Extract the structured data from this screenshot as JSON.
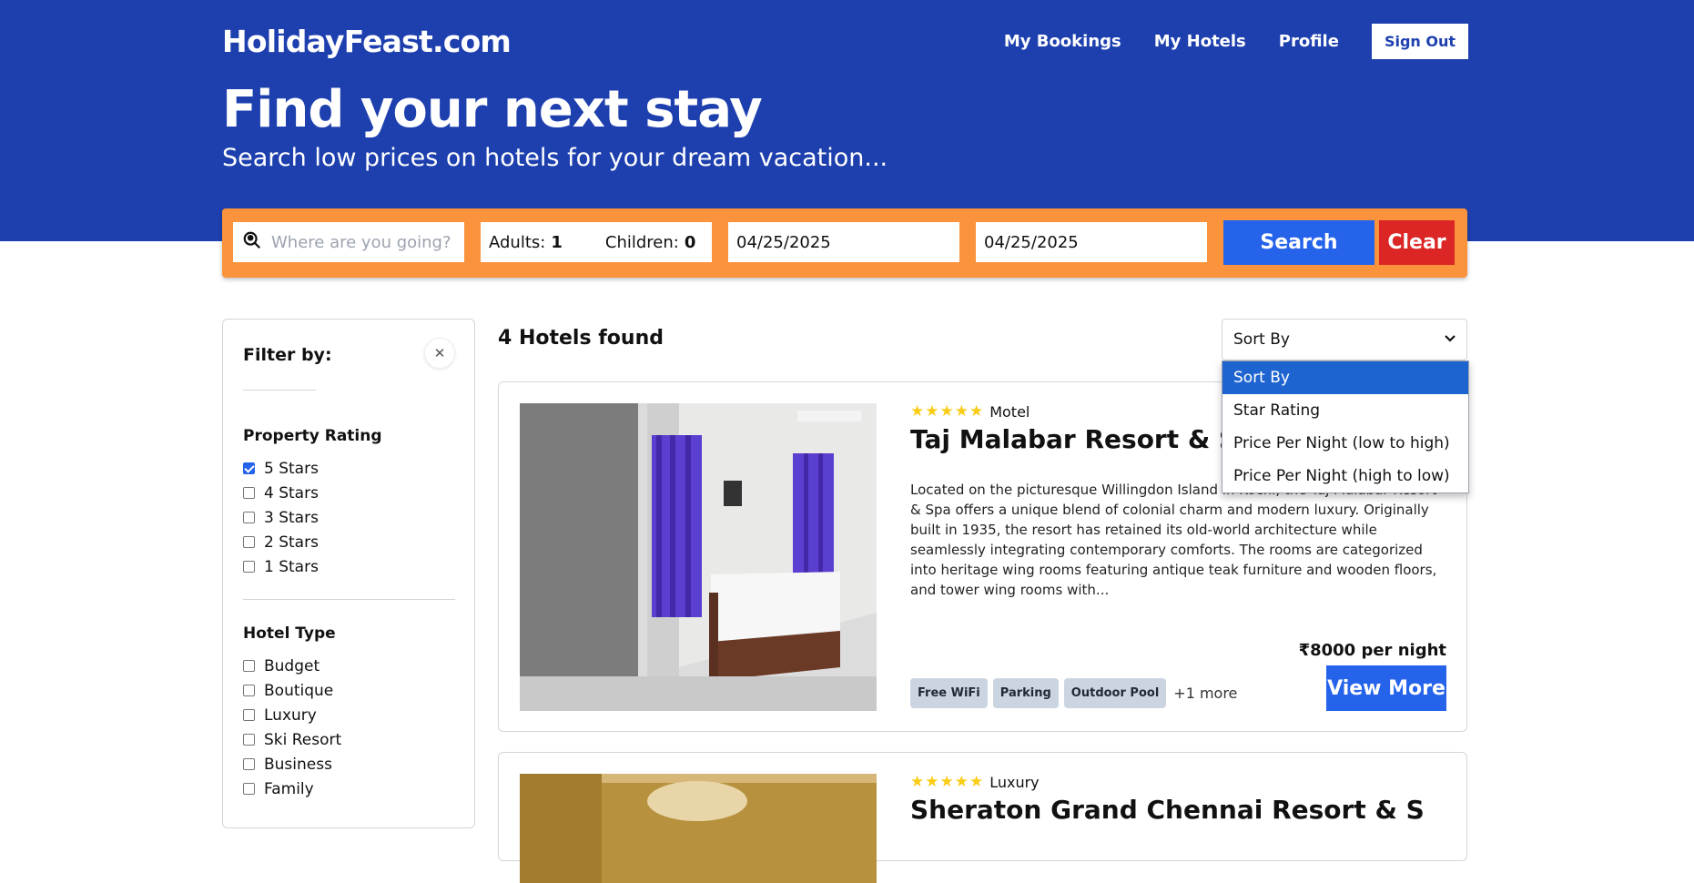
{
  "header": {
    "brand": "HolidayFeast.com",
    "nav": [
      "My Bookings",
      "My Hotels",
      "Profile"
    ],
    "sign_out": "Sign Out",
    "headline": "Find your next stay",
    "subline": "Search low prices on hotels for your dream vacation..."
  },
  "search": {
    "destination_placeholder": "Where are you going?",
    "adults_label": "Adults:",
    "adults_value": "1",
    "children_label": "Children:",
    "children_value": "0",
    "check_in": "04/25/2025",
    "check_out": "04/25/2025",
    "search_label": "Search",
    "clear_label": "Clear"
  },
  "filters": {
    "title": "Filter by:",
    "close_icon": "close-icon",
    "rating_title": "Property Rating",
    "ratings": [
      {
        "label": "5 Stars",
        "checked": true
      },
      {
        "label": "4 Stars",
        "checked": false
      },
      {
        "label": "3 Stars",
        "checked": false
      },
      {
        "label": "2 Stars",
        "checked": false
      },
      {
        "label": "1 Stars",
        "checked": false
      }
    ],
    "type_title": "Hotel Type",
    "types": [
      {
        "label": "Budget",
        "checked": false
      },
      {
        "label": "Boutique",
        "checked": false
      },
      {
        "label": "Luxury",
        "checked": false
      },
      {
        "label": "Ski Resort",
        "checked": false
      },
      {
        "label": "Business",
        "checked": false
      },
      {
        "label": "Family",
        "checked": false
      }
    ]
  },
  "results": {
    "count_text": "4 Hotels found",
    "sort_label": "Sort By",
    "sort_options": [
      "Sort By",
      "Star Rating",
      "Price Per Night (low to high)",
      "Price Per Night (high to low)"
    ],
    "sort_selected": "Sort By"
  },
  "hotels": [
    {
      "stars": "★★★★★",
      "type": "Motel",
      "name": "Taj Malabar Resort & Spa, C",
      "description": "Located on the picturesque Willingdon Island in Kochi, the Taj Malabar Resort & Spa offers a unique blend of colonial charm and modern luxury. Originally built in 1935, the resort has retained its old-world architecture while seamlessly integrating contemporary comforts. The rooms are categorized into heritage wing rooms featuring antique teak furniture and wooden floors, and tower wing rooms with...",
      "price": "₹8000 per night",
      "facilities": [
        "Free WiFi",
        "Parking",
        "Outdoor Pool"
      ],
      "more": "+1 more",
      "view_more": "View More"
    },
    {
      "stars": "★★★★★",
      "type": "Luxury",
      "name": "Sheraton Grand Chennai Resort & S"
    }
  ],
  "colors": {
    "header_bg": "#1e40af",
    "search_bar_bg": "#fb923c",
    "primary": "#2563eb",
    "danger": "#dc2626",
    "star": "#facc15"
  }
}
